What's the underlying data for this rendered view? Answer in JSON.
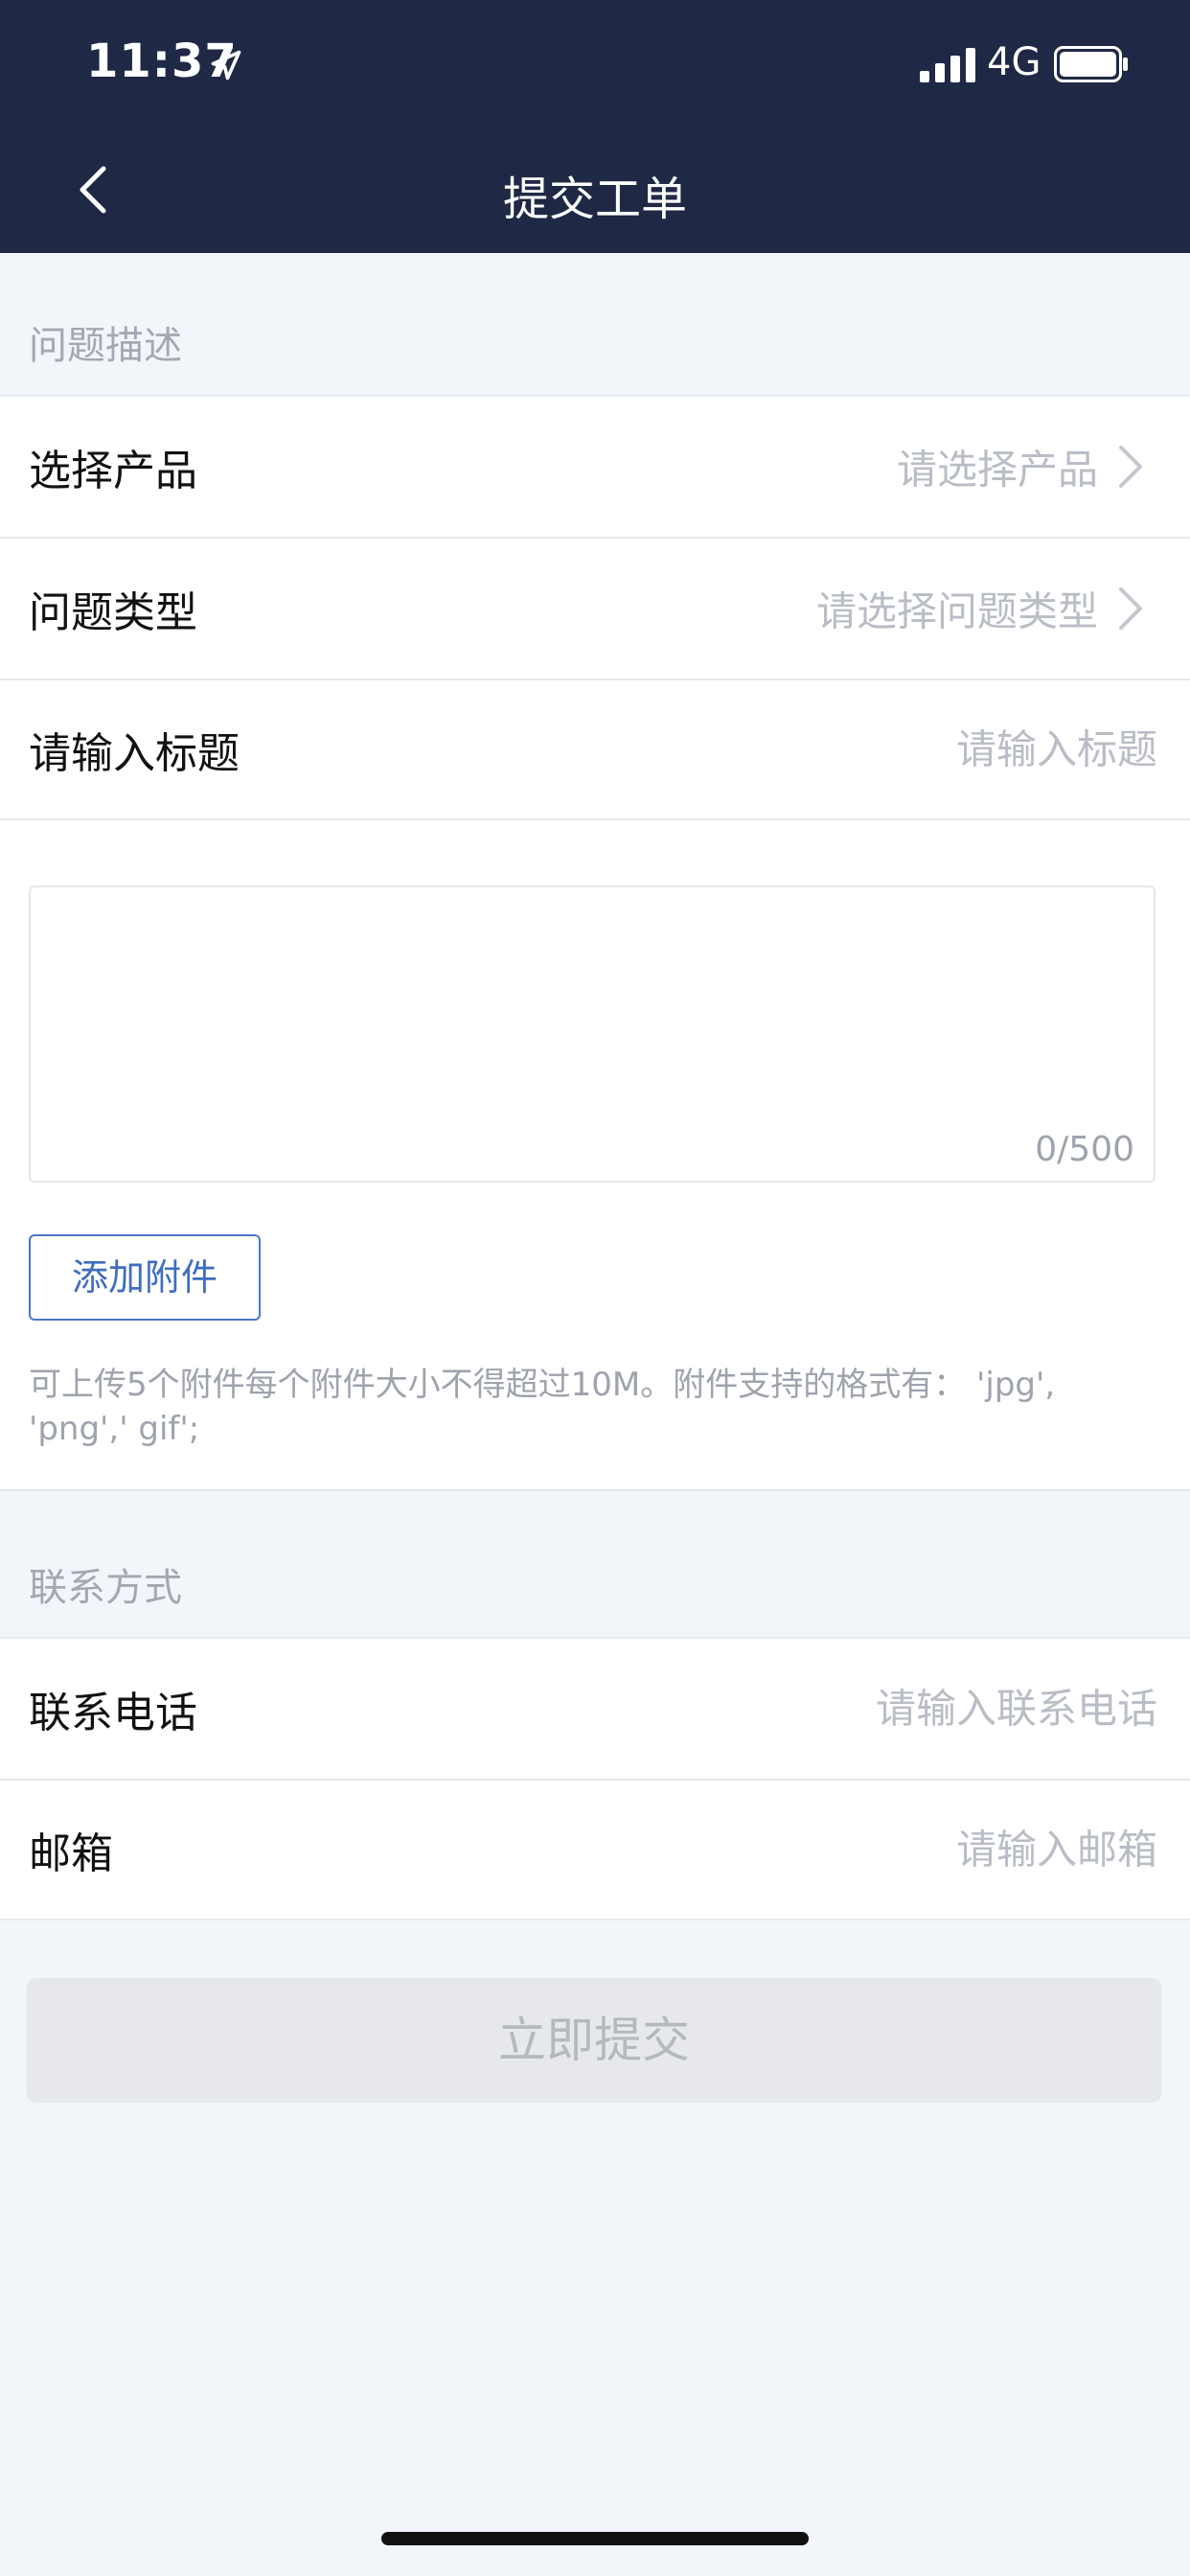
{
  "status_bar": {
    "time": "11:37",
    "network": "4G"
  },
  "nav": {
    "title": "提交工单"
  },
  "sections": {
    "problem": "问题描述",
    "contact": "联系方式"
  },
  "problem_rows": [
    {
      "label": "选择产品",
      "placeholder": "请选择产品"
    },
    {
      "label": "问题类型",
      "placeholder": "请选择问题类型"
    },
    {
      "label": "请输入标题",
      "placeholder": "请输入标题"
    }
  ],
  "description": {
    "counter": "0/500",
    "attach_label": "添加附件",
    "attach_hint": "可上传5个附件每个附件大小不得超过10M。附件支持的格式有： 'jpg', 'png',' gif';"
  },
  "contact_rows": [
    {
      "label": "联系电话",
      "placeholder": "请输入联系电话"
    },
    {
      "label": "邮箱",
      "placeholder": "请输入邮箱"
    }
  ],
  "submit": {
    "label": "立即提交"
  },
  "colors": {
    "header_bg": "#1f2945",
    "accent": "#3f6dc0",
    "page_bg": "#f2f5fa"
  }
}
